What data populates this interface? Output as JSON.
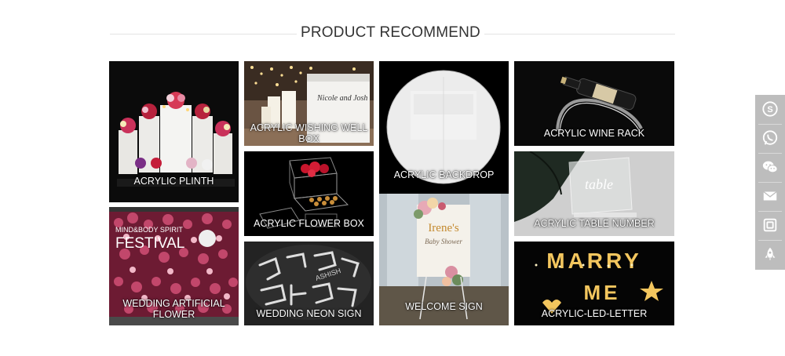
{
  "section": {
    "title": "PRODUCT RECOMMEND"
  },
  "products": [
    {
      "label": "ACRYLIC PLINTH"
    },
    {
      "label": "ACRYLIC WISHING WELL BOX"
    },
    {
      "label": "ACRYLIC BACKDROP"
    },
    {
      "label": "ACRYLIC WINE RACK"
    },
    {
      "label": "WEDDING ARTIFICIAL FLOWER"
    },
    {
      "label": "ACRYLIC FLOWER BOX"
    },
    {
      "label": "ACRYLIC TABLE NUMBER"
    },
    {
      "label": "WEDDING NEON SIGN"
    },
    {
      "label": "WELCOME SIGN"
    },
    {
      "label": "ACRYLIC-LED-LETTER"
    }
  ],
  "image_text": {
    "festival_line1": "MIND&BODY SPIRIT",
    "festival_line2": "FESTIVAL",
    "welcome_name": "Irene's",
    "welcome_sub": "Baby Shower",
    "table_word": "table",
    "marry_top": "MARRY",
    "marry_me": "ME",
    "wishing_names": "Nicole and Josh"
  },
  "sidebar": {
    "icons": [
      "skype-icon",
      "whatsapp-icon",
      "wechat-icon",
      "email-icon",
      "instagram-icon",
      "rocket-icon"
    ]
  }
}
